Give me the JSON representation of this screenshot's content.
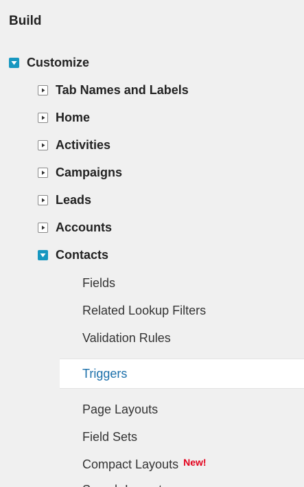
{
  "build": {
    "title": "Build",
    "customize": {
      "label": "Customize",
      "items": [
        {
          "label": "Tab Names and Labels"
        },
        {
          "label": "Home"
        },
        {
          "label": "Activities"
        },
        {
          "label": "Campaigns"
        },
        {
          "label": "Leads"
        },
        {
          "label": "Accounts"
        }
      ],
      "contacts": {
        "label": "Contacts",
        "children": [
          {
            "label": "Fields"
          },
          {
            "label": "Related Lookup Filters"
          },
          {
            "label": "Validation Rules"
          },
          {
            "label": "Triggers",
            "selected": true
          },
          {
            "label": "Page Layouts"
          },
          {
            "label": "Field Sets"
          },
          {
            "label": "Compact Layouts",
            "badge": "New!"
          },
          {
            "label": "Search Layouts"
          }
        ]
      }
    }
  },
  "colors": {
    "panel_bg": "#f0f0f0",
    "toggle_open": "#1797c0",
    "selected_link": "#1a6faa",
    "new_badge": "#e3001b"
  },
  "icons": {
    "expanded": "collapse-square-icon",
    "collapsed": "expand-triangle-icon"
  }
}
